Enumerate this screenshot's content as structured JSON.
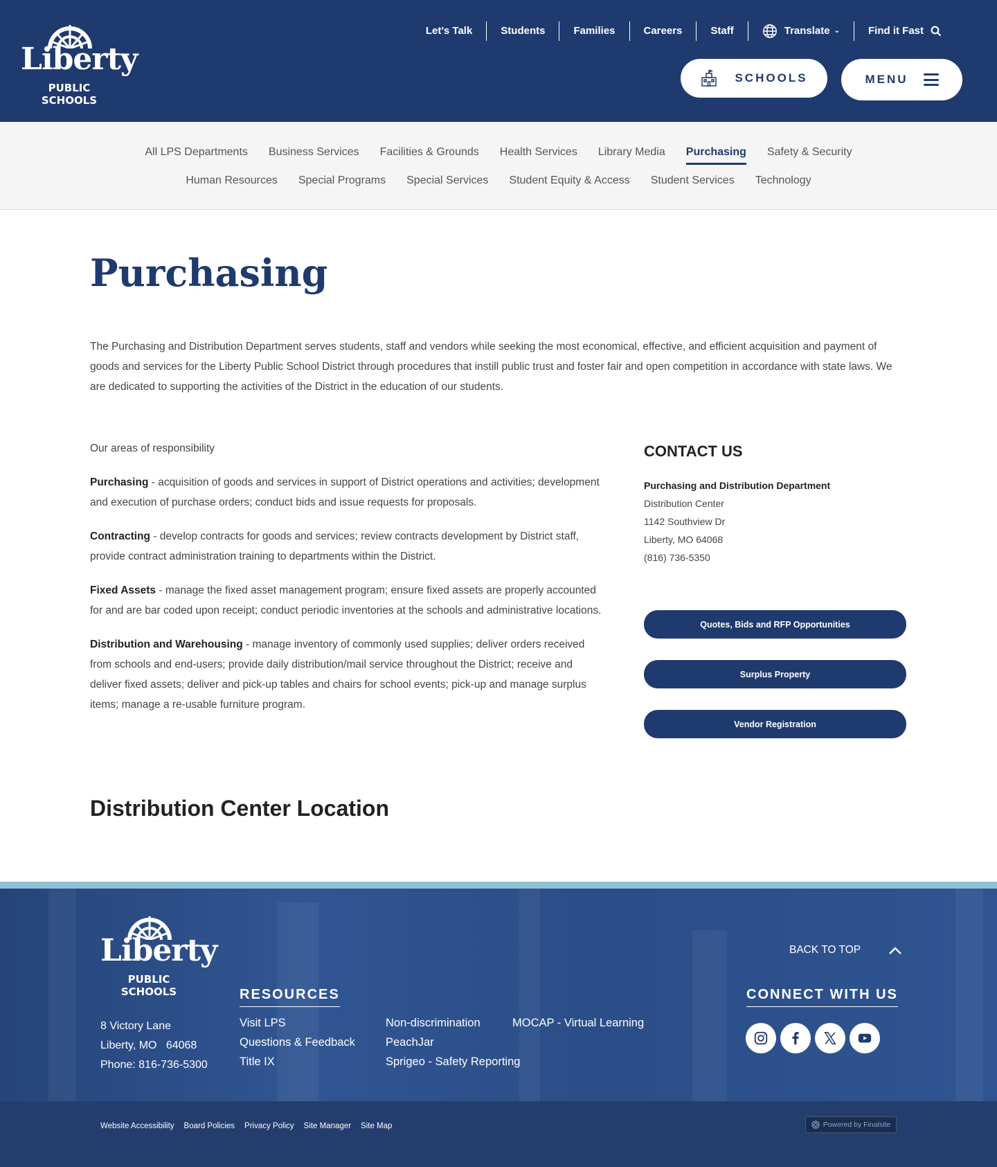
{
  "brand": {
    "logo_word": "Liberty",
    "logo_sub": "PUBLIC SCHOOLS"
  },
  "utility_nav": {
    "items": [
      "Let's Talk",
      "Students",
      "Families",
      "Careers",
      "Staff"
    ],
    "translate": "Translate",
    "find_it_fast": "Find it Fast"
  },
  "header_buttons": {
    "schools": "SCHOOLS",
    "menu": "MENU"
  },
  "subnav": {
    "row1": [
      "All LPS Departments",
      "Business Services",
      "Facilities & Grounds",
      "Health Services",
      "Library Media",
      "Purchasing",
      "Safety & Security"
    ],
    "row2": [
      "Human Resources",
      "Special Programs",
      "Special Services",
      "Student Equity & Access",
      "Student Services",
      "Technology"
    ],
    "active": "Purchasing"
  },
  "main": {
    "title": "Purchasing",
    "intro": "The Purchasing and Distribution Department serves students, staff and vendors while seeking the most economical, effective, and efficient acquisition and payment of goods and services for the Liberty Public School District through procedures that instill public trust and foster fair and open competition in accordance with state laws. We are dedicated to supporting the activities of the District in the education of our students.",
    "areas_title": "Our areas of responsibility",
    "responsibilities": [
      {
        "name": "Purchasing",
        "text": " - acquisition of goods and services in support of District operations and activities; development and execution of purchase orders; conduct bids and issue requests for proposals."
      },
      {
        "name": "Contracting",
        "text": " - develop contracts for goods and services; review contracts development by District staff, provide contract administration training to departments within the District."
      },
      {
        "name": "Fixed Assets",
        "text": " - manage the fixed asset management program; ensure fixed assets are properly accounted for and are bar coded upon receipt; conduct periodic inventories at the schools and administrative locations."
      },
      {
        "name": "Distribution and Warehousing",
        "text": " - manage inventory of commonly used supplies; deliver orders received from schools and end-users; provide daily distribution/mail service throughout the District; receive and deliver fixed assets; deliver and pick-up tables and chairs for school events; pick-up and manage surplus items; manage a re-usable furniture program."
      }
    ],
    "section_title": "Distribution Center Location"
  },
  "contact": {
    "title": "CONTACT US",
    "dept": "Purchasing and Distribution Department",
    "location": "Distribution Center",
    "street": "1142 Southview Dr",
    "city": "Liberty, MO 64068",
    "phone": "(816) 736-5350",
    "buttons": [
      "Quotes, Bids and RFP Opportunities",
      "Surplus Property",
      "Vendor Registration"
    ]
  },
  "footer": {
    "address": [
      "8 Victory Lane",
      "Liberty, MO   64068",
      "Phone: 816-736-5300"
    ],
    "resources_title": "RESOURCES",
    "resources_col1": [
      "Visit LPS",
      "Questions & Feedback",
      "Title IX"
    ],
    "resources_col2": [
      "Non-discrimination",
      "PeachJar",
      "Sprigeo - Safety Reporting"
    ],
    "resources_col3": [
      "MOCAP - Virtual Learning"
    ],
    "back_to_top": "BACK TO TOP",
    "connect_title": "CONNECT WITH US",
    "social": [
      "instagram-icon",
      "facebook-icon",
      "x-icon",
      "youtube-icon"
    ],
    "bottom_links": [
      "Website Accessibility",
      "Board Policies",
      "Privacy Policy",
      "Site Manager",
      "Site Map"
    ],
    "powered": "Powered by Finalsite"
  },
  "colors": {
    "brand_navy": "#1f3a6e",
    "footer_blue": "#2f5390",
    "stripe": "#8fc1d6"
  }
}
